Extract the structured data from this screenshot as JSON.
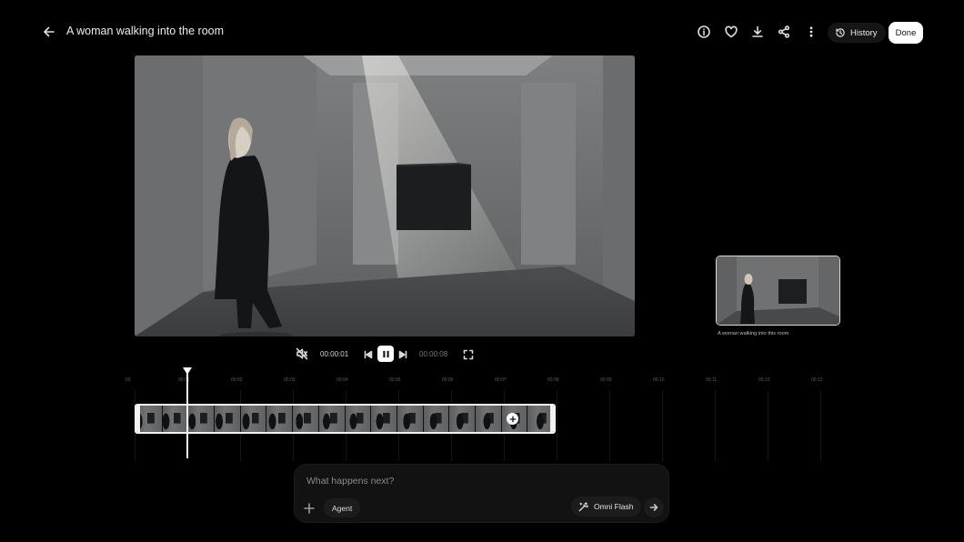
{
  "header": {
    "back_icon": "arrow-left-icon",
    "title": "A woman walking into the room",
    "toolbar": [
      "info-icon",
      "heart-icon",
      "download-icon",
      "share-icon",
      "more-vert-icon"
    ],
    "history_label": "History",
    "done_label": "Done"
  },
  "player": {
    "current_time": "00:00:01",
    "total_time": "00:00:08",
    "state": "playing",
    "controls": [
      "mute-icon",
      "skip-previous-icon",
      "pause-icon",
      "skip-next-icon",
      "fullscreen-icon"
    ]
  },
  "thumbnail": {
    "caption": "A woman walking into this room"
  },
  "timeline": {
    "ticks": [
      "00",
      "00:01",
      "00:02",
      "00:03",
      "00:04",
      "00:05",
      "00:06",
      "00:07",
      "00:08",
      "00:09",
      "00:10",
      "00:11",
      "00:12",
      "00:13"
    ],
    "clip_frames": 16,
    "playhead_time": "00:00:01"
  },
  "prompt": {
    "placeholder": "What happens next?",
    "value": "",
    "agent_label": "Agent",
    "model_label": "Omni Flash"
  },
  "colors": {
    "background": "#000000",
    "done_button": "#ffffff"
  }
}
